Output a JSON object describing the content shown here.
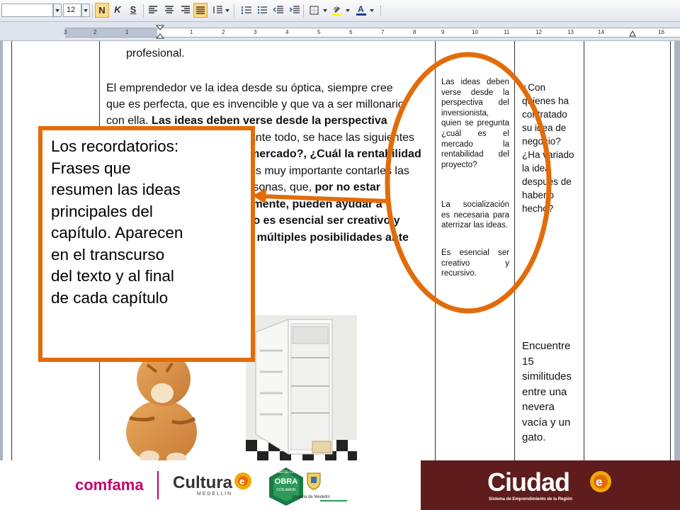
{
  "toolbar": {
    "font_size": "12",
    "bold_label": "N",
    "italic_label": "K",
    "underline_label": "S"
  },
  "ruler": {
    "numbers": [
      "3",
      "2",
      "1",
      "1",
      "2",
      "3",
      "4",
      "5",
      "6",
      "7",
      "8",
      "9",
      "10",
      "11",
      "12",
      "13",
      "14",
      "16"
    ]
  },
  "document": {
    "top_line": "profesional.",
    "paragraph": {
      "l1": "El emprendedor ve la idea desde su óptica, siempre cree",
      "l2": "que es perfecta, que es invencible y que va a ser millonario",
      "l3a": "con ella. ",
      "l3b": "Las ideas deben verse desde la perspectiva",
      "l4": "ante todo, se hace las siguientes",
      "l5a": "mercado?, ",
      "l5b": "¿Cuál la rentabilidad",
      "l6": "es muy importante contarles las",
      "l7a": "rsonas, que, ",
      "l7b": "por no estar",
      "l8": "lmente, pueden ayudar a",
      "l9": "to es esencial ser creativo y",
      "l10": "r múltiples posibilidades ante"
    },
    "side_note_1": "Las ideas deben verse desde la perspectiva del inversionista, quien se pregunta ¿cuál es el mercado la rentabilidad del proyecto?",
    "side_note_2": "La socialización es necesaria para aterrizar las ideas.",
    "side_note_3": "Es esencial ser creativo y recursivo.",
    "side_question": [
      "¿Con",
      "quienes ha",
      "contratado",
      "su idea de",
      "negocio?",
      "¿Ha variado",
      "la idea",
      "después de",
      "haberlo",
      "hecho?"
    ],
    "side_activity": [
      "Encuentre",
      "15",
      "similitudes",
      "entre una",
      "nevera",
      "vacía y un",
      "gato."
    ]
  },
  "callout": {
    "lines": [
      "Los recordatorios:",
      "Frases que",
      "resumen las ideas",
      "principales del",
      "capítulo. Aparecen",
      "en el transcurso",
      "del texto y al final",
      "de cada capítulo"
    ]
  },
  "footer": {
    "logo_comfama": "comfama",
    "logo_cultura": "Cultura",
    "logo_cultura_sub": "M E D E L L Í N",
    "logo_obra_top": "MEDELLÍN",
    "logo_obra": "OBRA",
    "logo_obra_sub": "CON AMOR",
    "logo_alcaldia": "Alcaldía de Medellín",
    "logo_ciudad": "Ciudad",
    "logo_ciudad_sub": "Sistema de Emprendimiento de la Región"
  },
  "colors": {
    "accent_orange": "#e36c0a",
    "footer_maroon": "#5e1c1c",
    "comfama_magenta": "#c4006b"
  }
}
